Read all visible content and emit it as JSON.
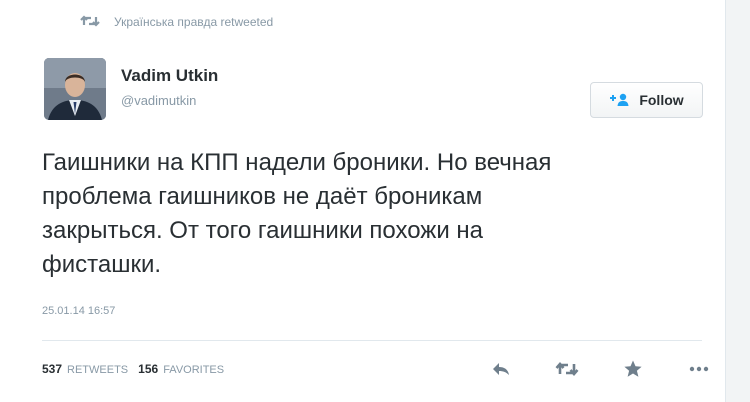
{
  "retweet_context": {
    "text": "Українська правда retweeted",
    "icon": "retweet-icon"
  },
  "author": {
    "name": "Vadim Utkin",
    "handle": "@vadimutkin",
    "avatar_icon": "avatar-photo"
  },
  "follow_button": {
    "label": "Follow",
    "icon": "add-user-icon",
    "accent_color": "#1da1f2"
  },
  "tweet": {
    "text": "Гаишники на КПП надели броники. Но вечная\nпроблема гаишников не даёт броникам\nзакрыться. От того гаишники похожи на\nфисташки.",
    "timestamp": "25.01.14 16:57"
  },
  "stats": {
    "retweets_count": "537",
    "retweets_label": "RETWEETS",
    "favorites_count": "156",
    "favorites_label": "FAVORITES"
  },
  "actions": [
    {
      "icon": "reply-icon"
    },
    {
      "icon": "retweet-icon"
    },
    {
      "icon": "favorite-star-icon"
    },
    {
      "icon": "more-dots-icon"
    }
  ],
  "colors": {
    "secondary_text": "#8899a6",
    "primary_text": "#292f33",
    "action_icon": "#6f7f8c"
  }
}
